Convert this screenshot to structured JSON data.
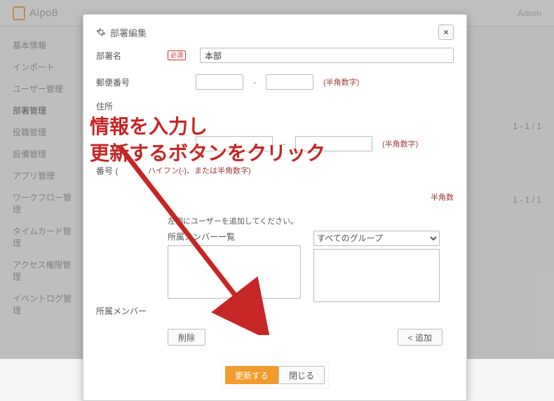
{
  "brand": "Aipo8",
  "admin": "Admin",
  "sidebar": {
    "items": [
      {
        "label": "基本情報"
      },
      {
        "label": "インポート"
      },
      {
        "label": "ユーザー管理"
      },
      {
        "label": "部署管理"
      },
      {
        "label": "役職管理"
      },
      {
        "label": "設備管理"
      },
      {
        "label": "アプリ管理"
      },
      {
        "label": "ワークフロー管理"
      },
      {
        "label": "タイムカード管理"
      },
      {
        "label": "アクセス権限管理"
      },
      {
        "label": "イベントログ管理"
      }
    ],
    "active_index": 3
  },
  "pagers": {
    "p1": "1 - 1 / 1",
    "p2": "1 - 1 / 1"
  },
  "modal": {
    "title": "部署編集",
    "required_badge": "必須",
    "labels": {
      "name": "部署名",
      "postal": "郵便番号",
      "address": "住所",
      "phone_partial": "番号 (",
      "members": "所属メンバー"
    },
    "values": {
      "name": "本部"
    },
    "hints": {
      "han_num": "(半角数字)",
      "hyphen": "ハイフン(-)、または半角数字)",
      "han_num2": "半角数"
    },
    "instruction": "左側にユーザーを追加してください。",
    "member_list_title": "所属メンバー一覧",
    "group_select": "すべてのグループ",
    "btn_delete": "削除",
    "btn_add": "< 追加",
    "btn_submit": "更新する",
    "btn_close": "閉じる"
  },
  "annotation": {
    "line1": "情報を入力し",
    "line2": "更新するボタンをクリック"
  }
}
